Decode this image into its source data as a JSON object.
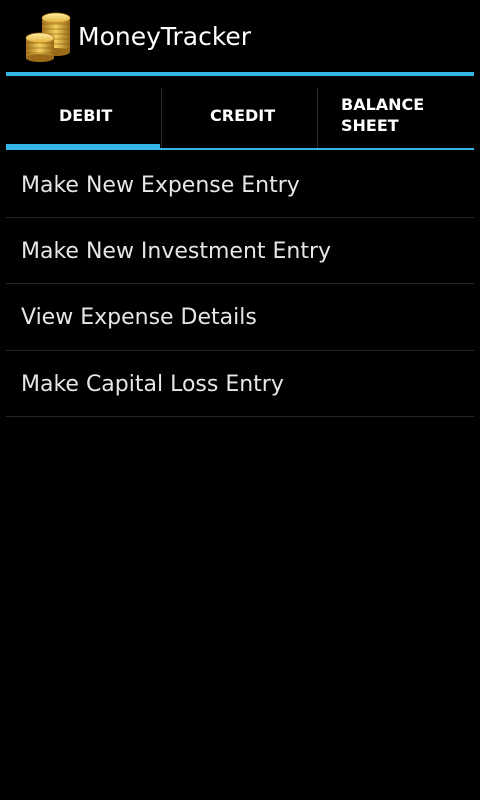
{
  "app": {
    "title": "MoneyTracker",
    "icon": "coins-icon",
    "accent_color": "#33b5e5"
  },
  "tabs": [
    {
      "label": "DEBIT",
      "selected": true
    },
    {
      "label": "CREDIT",
      "selected": false
    },
    {
      "label_line1": "BALANCE",
      "label_line2": "SHEET",
      "selected": false
    }
  ],
  "menu": {
    "items": [
      {
        "label": "Make New Expense Entry"
      },
      {
        "label": "Make New Investment Entry"
      },
      {
        "label": "View Expense Details"
      },
      {
        "label": "Make Capital Loss Entry"
      }
    ]
  }
}
